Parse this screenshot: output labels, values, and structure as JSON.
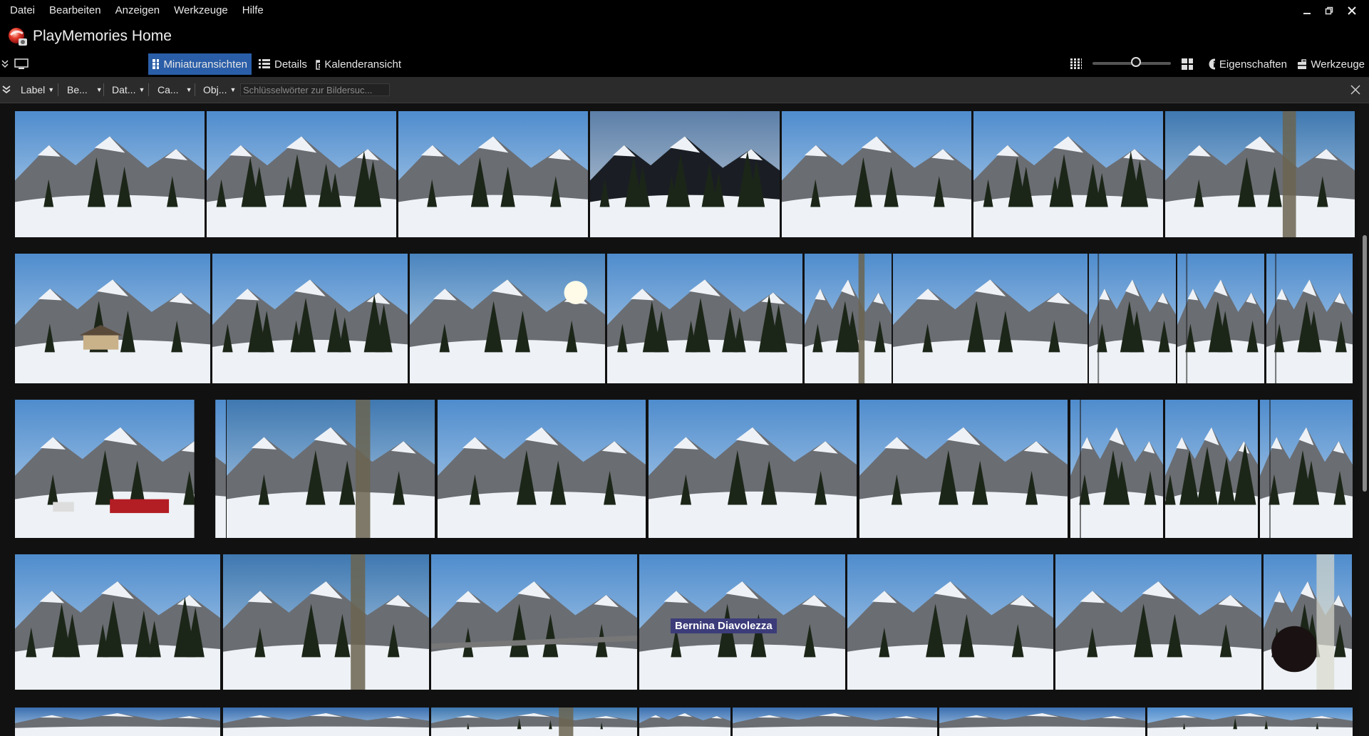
{
  "menu": {
    "items": [
      "Datei",
      "Bearbeiten",
      "Anzeigen",
      "Werkzeuge",
      "Hilfe"
    ]
  },
  "app": {
    "title": "PlayMemories Home"
  },
  "views": {
    "thumbnails": "Miniaturansichten",
    "details": "Details",
    "calendar": "Kalenderansicht",
    "properties": "Eigenschaften",
    "tools": "Werkzeuge",
    "zoom_level": 0.55
  },
  "filters": {
    "label": "Label",
    "rating": "Be...",
    "date": "Dat...",
    "camera": "Ca...",
    "object": "Obj...",
    "search_placeholder": "Schlüsselwörter zur Bildersuc..."
  },
  "photos": {
    "sign_text": "Bernina Diavolezza"
  },
  "colors": {
    "accent": "#2a5ea8",
    "background": "#111111",
    "filterbar": "#2b2b2b"
  }
}
